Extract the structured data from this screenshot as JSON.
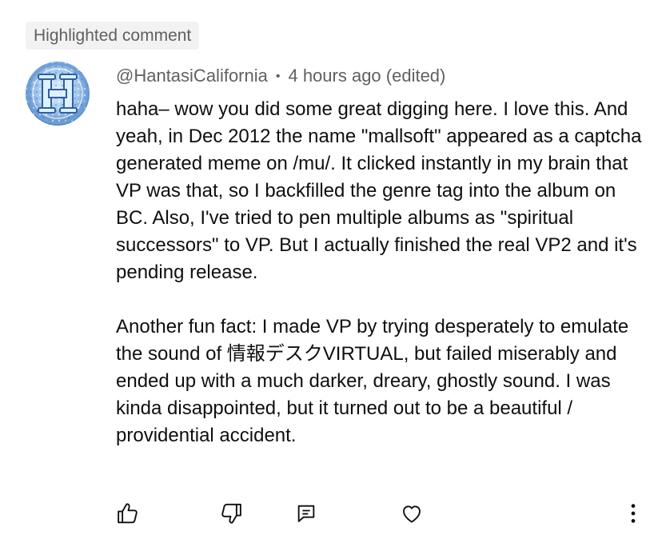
{
  "badge": "Highlighted comment",
  "comment": {
    "author": "@HantasiCalifornia",
    "separator": "•",
    "time": "4 hours ago (edited)",
    "paragraphs": [
      "haha– wow you did some great digging here. I love this. And yeah, in Dec 2012 the name \"mallsoft\" appeared as a captcha generated meme on /mu/. It clicked instantly in my brain that VP was that, so I backfilled the genre tag into the album on BC. Also, I've tried to pen multiple albums as \"spiritual successors\" to VP. But I actually finished the real VP2 and it's pending release.",
      "Another fun fact: I made VP by trying desperately to emulate the sound of 情報デスクVIRTUAL, but failed miserably and ended up with a much darker, dreary, ghostly sound. I was kinda disappointed, but it turned out to be a beautiful / providential accident."
    ]
  },
  "actions": {
    "like": "thumbs-up-icon",
    "dislike": "thumbs-down-icon",
    "reply": "reply-comment-icon",
    "heart": "heart-icon",
    "more": "more-vertical-icon"
  },
  "colors": {
    "text": "#0f0f0f",
    "secondary": "#606060",
    "badge_bg": "#f2f2f2"
  }
}
